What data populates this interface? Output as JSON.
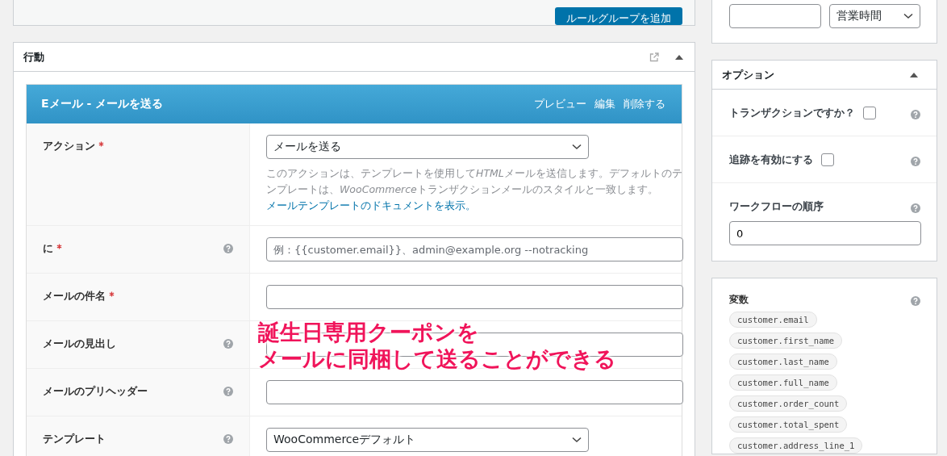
{
  "top_panel": {
    "button": "ルールグループを追加"
  },
  "actions_panel": {
    "title": "行動",
    "expanded": true,
    "action": {
      "title": "Eメール - メールを送る",
      "links": [
        "プレビュー",
        "編集",
        "削除する"
      ],
      "fields": [
        {
          "kind": "select",
          "label": "アクション",
          "required": true,
          "help": false,
          "value": "メールを送る",
          "description": [
            {
              "kind": "plain",
              "text": "このアクションは、テンプレートを使用して"
            },
            {
              "kind": "italic",
              "text": "HTML"
            },
            {
              "kind": "plain",
              "text": "メールを送信します。デフォルトのテンプレートは、"
            },
            {
              "kind": "italic",
              "text": "WooCommerce"
            },
            {
              "kind": "plain",
              "text": "トランザクションメールのスタイルと一致します。"
            }
          ],
          "link": "メールテンプレートのドキュメントを表示。"
        },
        {
          "kind": "text",
          "label": "に",
          "required": true,
          "help": true,
          "placeholder": "例：{{customer.email}}、admin@example.org --notracking"
        },
        {
          "kind": "text",
          "label": "メールの件名",
          "required": true,
          "help": false
        },
        {
          "kind": "text",
          "label": "メールの見出し",
          "required": false,
          "help": true
        },
        {
          "kind": "text",
          "label": "メールのプリヘッダー",
          "required": false,
          "help": true
        },
        {
          "kind": "select",
          "label": "テンプレート",
          "required": false,
          "help": true,
          "value": "WooCommerceデフォルト"
        }
      ]
    }
  },
  "annotation": {
    "lines": [
      "誕生日専用クーポンを",
      "メールに同梱して送ることができる"
    ]
  },
  "sidebar": {
    "top_panel": {
      "select": "営業時間"
    },
    "options": {
      "title": "オプション",
      "expanded": true,
      "rows": [
        {
          "kind": "checkbox",
          "label": "トランザクションですか？",
          "checked": false
        },
        {
          "kind": "checkbox",
          "label": "追跡を有効にする",
          "checked": false
        },
        {
          "kind": "number",
          "label": "ワークフローの順序",
          "value": "0"
        }
      ]
    },
    "variables": {
      "title": "変数",
      "items": [
        "customer.email",
        "customer.first_name",
        "customer.last_name",
        "customer.full_name",
        "customer.order_count",
        "customer.total_spent",
        "customer.address_line_1"
      ]
    }
  }
}
